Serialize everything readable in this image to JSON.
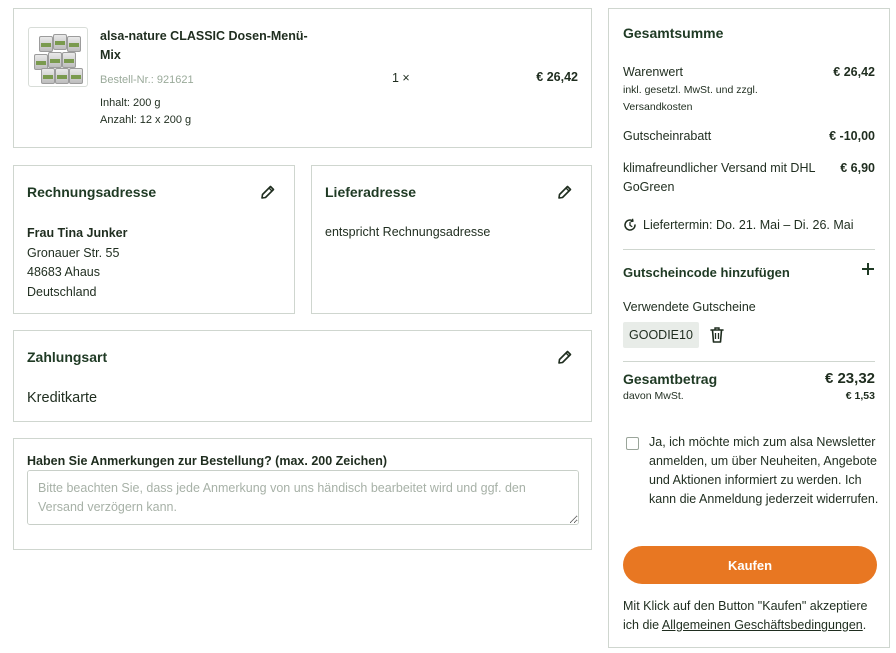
{
  "product": {
    "name": "alsa-nature CLASSIC Dosen-Menü-Mix",
    "sku_label": "Bestell-Nr.:",
    "sku": "921621",
    "content": "Inhalt: 200 g",
    "amount": "Anzahl: 12 x 200 g",
    "qty": "1 ×",
    "price": "€ 26,42"
  },
  "billing": {
    "title": "Rechnungsadresse",
    "name": "Frau Tina Junker",
    "street": "Gronauer Str. 55",
    "city": "48683 Ahaus",
    "country": "Deutschland"
  },
  "shipping": {
    "title": "Lieferadresse",
    "text": "entspricht Rechnungsadresse"
  },
  "payment": {
    "title": "Zahlungsart",
    "method": "Kreditkarte"
  },
  "notes": {
    "label": "Haben Sie Anmerkungen zur Bestellung? (max. 200 Zeichen)",
    "placeholder": "Bitte beachten Sie, dass jede Anmerkung von uns händisch bearbeitet wird und ggf. den Versand verzögern kann."
  },
  "summary": {
    "title": "Gesamtsumme",
    "goods_label": "Warenwert",
    "goods_value": "€ 26,42",
    "goods_note": "inkl. gesetzl. MwSt. und zzgl. Versandkosten",
    "voucher_label": "Gutscheinrabatt",
    "voucher_value": "€ -10,00",
    "shipping_label": "klimafreundlicher Versand mit DHL GoGreen",
    "shipping_value": "€ 6,90",
    "delivery": "Liefertermin: Do. 21. Mai – Di. 26. Mai",
    "voucher_add": "Gutscheincode hinzufügen",
    "used_vouchers": "Verwendete Gutscheine",
    "voucher_code": "GOODIE10",
    "total_label": "Gesamtbetrag",
    "total_value": "€ 23,32",
    "vat_label": "davon MwSt.",
    "vat_value": "€ 1,53",
    "newsletter": "Ja, ich möchte mich zum alsa Newsletter anmelden, um über Neuheiten, Angebote und Aktionen informiert zu werden. Ich kann die Anmeldung jederzeit widerrufen.",
    "buy_label": "Kaufen",
    "legal_prefix": "Mit Klick auf den Button \"Kaufen\" akzeptiere ich die ",
    "legal_link": "Allgemeinen Geschäftsbedingungen",
    "legal_suffix": "."
  },
  "colors": {
    "accent": "#e87722",
    "heading": "#1f3a24",
    "border": "#cfd6cf"
  },
  "icons": {
    "edit": "pencil-icon",
    "delivery": "clock-icon",
    "add": "plus-icon",
    "remove": "trash-icon"
  }
}
